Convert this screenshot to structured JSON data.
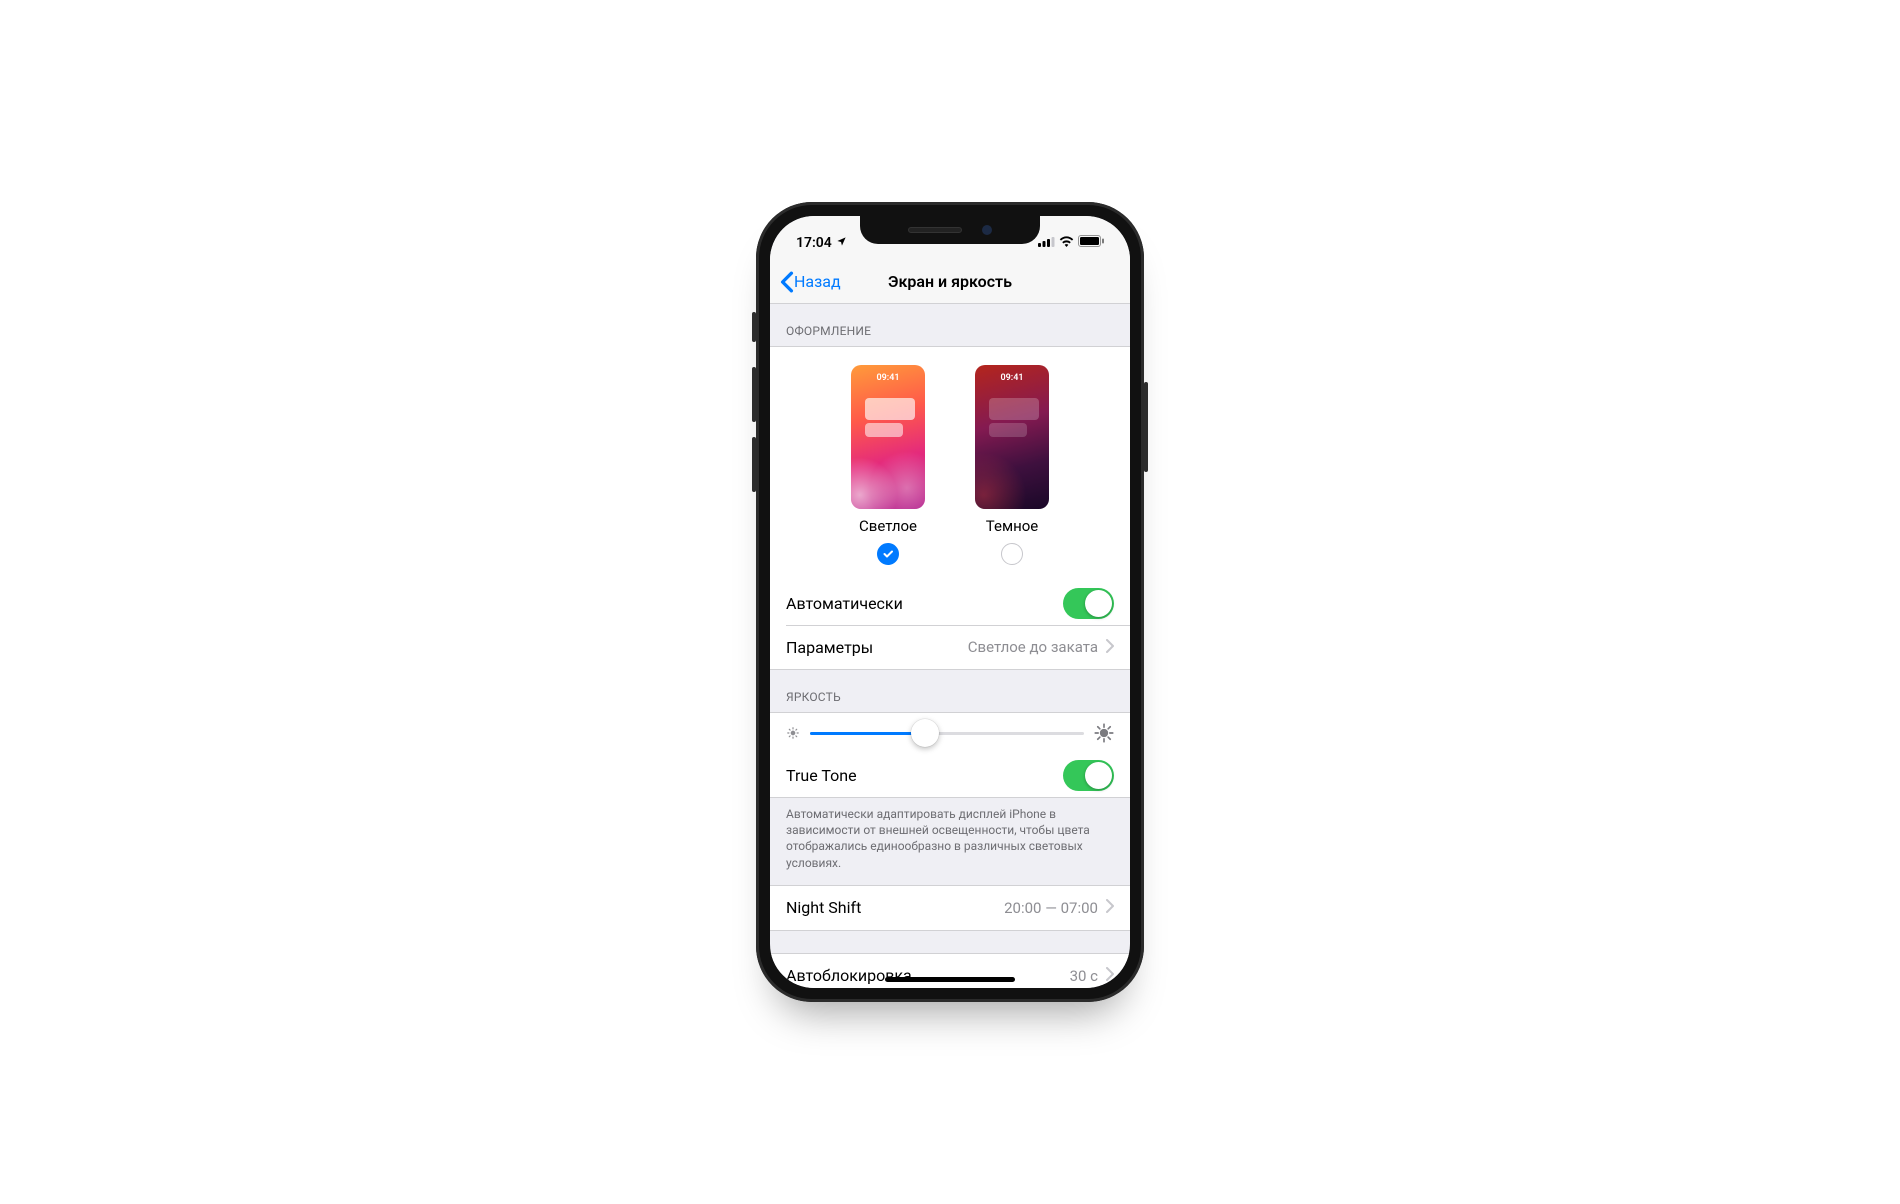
{
  "status": {
    "time": "17:04"
  },
  "nav": {
    "back": "Назад",
    "title": "Экран и яркость"
  },
  "appearance": {
    "header": "ОФОРМЛЕНИЕ",
    "preview_time": "09:41",
    "light_label": "Светлое",
    "dark_label": "Темное",
    "selected": "light",
    "automatic": {
      "label": "Автоматически",
      "enabled": true
    },
    "options": {
      "label": "Параметры",
      "value": "Светлое до заката"
    }
  },
  "brightness": {
    "header": "ЯРКОСТЬ",
    "slider_value_pct": 42,
    "true_tone": {
      "label": "True Tone",
      "enabled": true
    },
    "footer": "Автоматически адаптировать дисплей iPhone в зависимости от внешней освещенности, чтобы цвета отображались единообразно в различных световых условиях."
  },
  "night_shift": {
    "label": "Night Shift",
    "value": "20:00 — 07:00"
  },
  "auto_lock": {
    "label": "Автоблокировка",
    "value": "30 с"
  }
}
